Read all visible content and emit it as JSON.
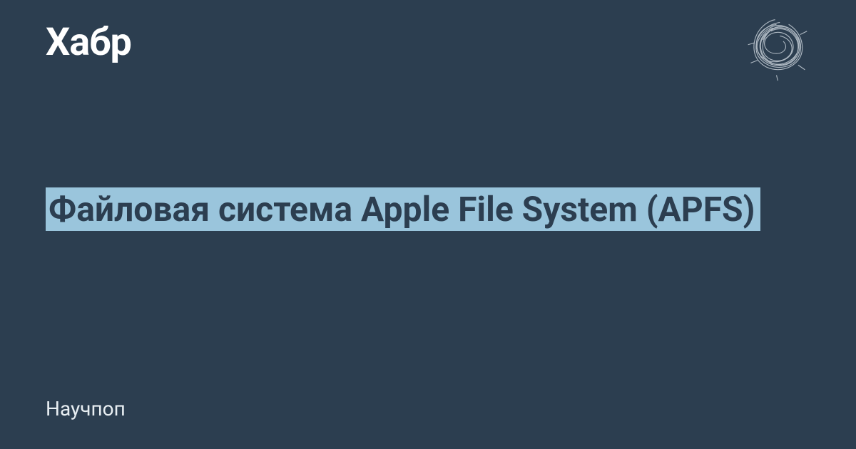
{
  "header": {
    "logo": "Хабр"
  },
  "main": {
    "title": "Файловая система Apple File System (APFS)"
  },
  "footer": {
    "category": "Научпоп"
  },
  "colors": {
    "background": "#2c3e50",
    "highlight": "#9ac5dc",
    "text_light": "#ffffff"
  }
}
